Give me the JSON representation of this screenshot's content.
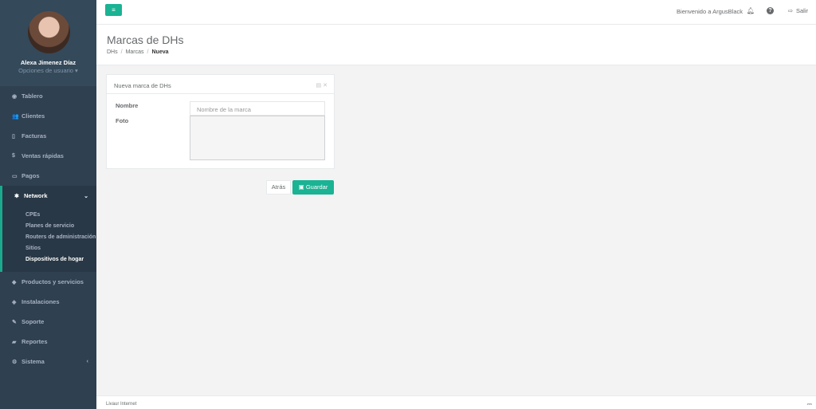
{
  "topbar": {
    "menu_icon": "hamburger-icon",
    "welcome_text": "Bienvenido a ArgusBlack",
    "logout_label": "Salir"
  },
  "profile": {
    "name": "Alexa Jimenez Díaz",
    "options_label": "Opciones de usuario ▾"
  },
  "sidebar": {
    "items": [
      {
        "label": "Tablero",
        "icon": "dashboard-icon"
      },
      {
        "label": "Clientes",
        "icon": "users-icon"
      },
      {
        "label": "Facturas",
        "icon": "file-icon"
      },
      {
        "label": "Ventas rápidas",
        "icon": "dollar-icon"
      },
      {
        "label": "Pagos",
        "icon": "money-icon"
      },
      {
        "label": "Network",
        "icon": "network-icon"
      },
      {
        "label": "Productos y servicios",
        "icon": "tags-icon"
      },
      {
        "label": "Instalaciones",
        "icon": "install-icon"
      },
      {
        "label": "Soporte",
        "icon": "wrench-icon"
      },
      {
        "label": "Reportes",
        "icon": "book-icon"
      },
      {
        "label": "Sistema",
        "icon": "cogs-icon"
      }
    ],
    "network_subitems": [
      "CPEs",
      "Planes de servicio",
      "Routers de administración",
      "Sitios",
      "Dispositivos de hogar"
    ]
  },
  "page": {
    "title": "Marcas de DHs",
    "breadcrumb": [
      "DHs",
      "Marcas",
      "Nueva"
    ]
  },
  "form": {
    "title": "Nueva marca de DHs",
    "name_label": "Nombre",
    "name_placeholder": "Nombre de la marca",
    "photo_label": "Foto",
    "back_label": "Atrás",
    "save_label": "Guardar"
  },
  "footer": {
    "text": "Livaur Internet"
  },
  "colors": {
    "accent": "#1ab394",
    "sidebar_bg": "#2f4050"
  }
}
